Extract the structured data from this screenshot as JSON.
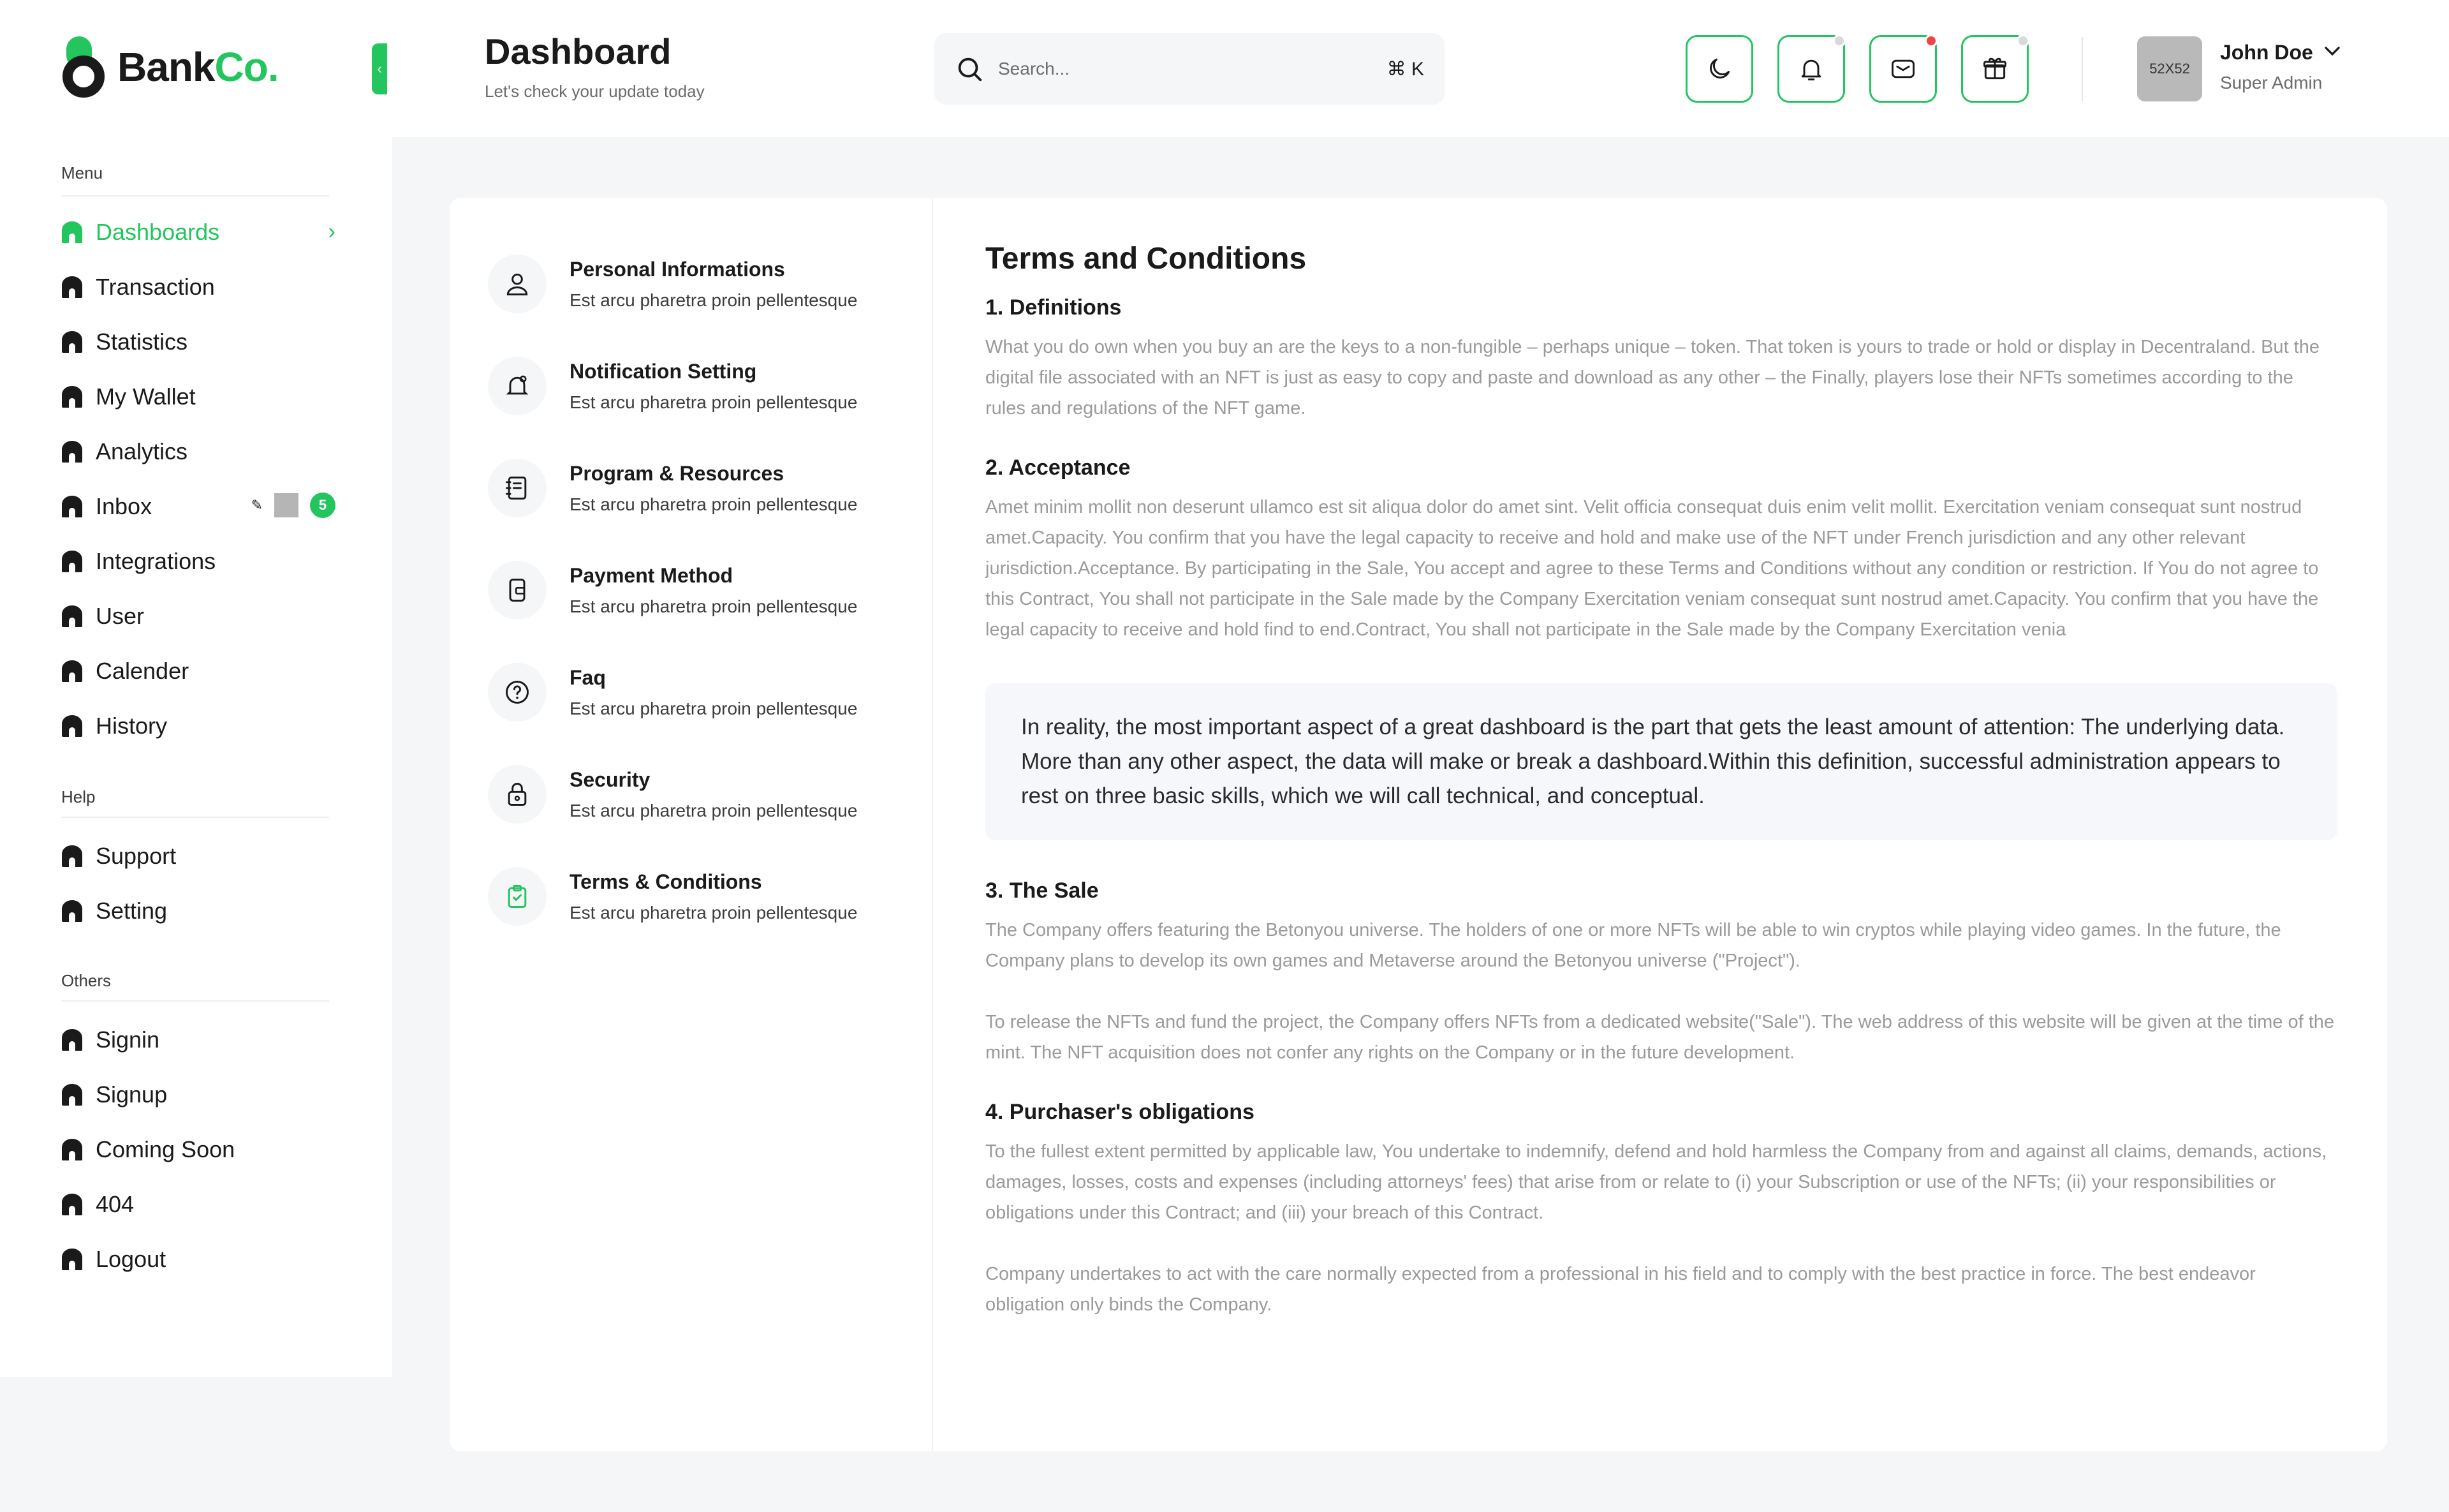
{
  "brand": {
    "name_part1": "Bank",
    "name_part2": "Co."
  },
  "header": {
    "title": "Dashboard",
    "subtitle": "Let's check your update today",
    "search_placeholder": "Search...",
    "search_shortcut": "⌘ K",
    "buttons": [
      {
        "icon": "moon-icon",
        "dot": null
      },
      {
        "icon": "bell-icon",
        "dot": "#d9d9d9"
      },
      {
        "icon": "message-icon",
        "dot": "#ef4444"
      },
      {
        "icon": "gift-icon",
        "dot": "#d9d9d9"
      }
    ],
    "user": {
      "avatar_text": "52X52",
      "name": "John Doe",
      "role": "Super Admin"
    }
  },
  "sidebar": {
    "sections": {
      "menu": "Menu",
      "help": "Help",
      "others": "Others"
    },
    "menu_items": [
      {
        "label": "Dashboards",
        "active": true
      },
      {
        "label": "Transaction"
      },
      {
        "label": "Statistics"
      },
      {
        "label": "My Wallet"
      },
      {
        "label": "Analytics"
      },
      {
        "label": "Inbox",
        "badge": "5"
      },
      {
        "label": "Integrations"
      },
      {
        "label": "User"
      },
      {
        "label": "Calender"
      },
      {
        "label": "History"
      }
    ],
    "help_items": [
      {
        "label": "Support"
      },
      {
        "label": "Setting"
      }
    ],
    "other_items": [
      {
        "label": "Signin"
      },
      {
        "label": "Signup"
      },
      {
        "label": "Coming Soon"
      },
      {
        "label": "404"
      },
      {
        "label": "Logout"
      }
    ],
    "accent_color": "#22c55e"
  },
  "settings": [
    {
      "title": "Personal Informations",
      "subtitle": "Est arcu pharetra proin pellentesque",
      "icon": "user-icon"
    },
    {
      "title": "Notification Setting",
      "subtitle": "Est arcu pharetra proin pellentesque",
      "icon": "bell-settings-icon"
    },
    {
      "title": "Program & Resources",
      "subtitle": "Est arcu pharetra proin pellentesque",
      "icon": "book-icon"
    },
    {
      "title": "Payment Method",
      "subtitle": "Est arcu pharetra proin pellentesque",
      "icon": "wallet-icon"
    },
    {
      "title": "Faq",
      "subtitle": "Est arcu pharetra proin pellentesque",
      "icon": "question-icon"
    },
    {
      "title": "Security",
      "subtitle": "Est arcu pharetra proin pellentesque",
      "icon": "lock-icon"
    },
    {
      "title": "Terms & Conditions",
      "subtitle": "Est arcu pharetra proin pellentesque",
      "icon": "clipboard-check-icon",
      "active": true
    }
  ],
  "terms": {
    "title": "Terms and Conditions",
    "s1_heading": "1. Definitions",
    "s1_body": "What you do own when you buy an are the keys to a non-fungible – perhaps unique – token. That token is yours to trade or hold or display in Decentraland. But the digital file associated with an NFT is just as easy to copy and paste and download as any other – the Finally, players lose their NFTs sometimes according to the rules and regulations of the NFT game.",
    "s2_heading": "2. Acceptance",
    "s2_body": "Amet minim mollit non deserunt ullamco est sit aliqua dolor do amet sint. Velit officia consequat duis enim velit mollit. Exercitation veniam consequat sunt nostrud amet.Capacity. You confirm that you have the legal capacity to receive and hold and make use of the NFT under French jurisdiction and any other relevant jurisdiction.Acceptance. By participating in the Sale, You accept and agree to these Terms and Conditions without any condition or restriction. If You do not agree to this Contract, You shall not participate in the Sale made by the Company Exercitation veniam consequat sunt nostrud amet.Capacity. You confirm that you have the legal capacity to receive and hold find to end.Contract, You shall not participate in the Sale made by the Company Exercitation venia",
    "quote": "In reality, the most important aspect of a great dashboard is the part that gets the least amount of attention: The underlying data. More than any other aspect, the data will make or break a dashboard.Within this definition, successful administration appears to rest on three basic skills, which we will call technical, and conceptual.",
    "s3_heading": "3. The Sale",
    "s3_body1": "The Company offers featuring the Betonyou universe. The holders of one or more NFTs will be able to win cryptos while playing video games. In the future, the Company plans to develop its own games and Metaverse around the Betonyou universe (\"Project\").",
    "s3_body2": "To release the NFTs and fund the project, the Company offers NFTs from a dedicated website(\"Sale\"). The web address of this website will be given at the time of the mint. The NFT acquisition does not confer any rights on the Company or in the future development.",
    "s4_heading": "4. Purchaser's obligations",
    "s4_body1": "To the fullest extent permitted by applicable law, You undertake to indemnify, defend and hold harmless the Company from and against all claims, demands, actions, damages, losses, costs and expenses (including attorneys' fees) that arise from or relate to (i) your Subscription or use of the NFTs; (ii) your responsibilities or obligations under this Contract; and (iii) your breach of this Contract.",
    "s4_body2": "Company undertakes to act with the care normally expected from a professional in his field and to comply with the best practice in force. The best endeavor obligation only binds the Company."
  }
}
